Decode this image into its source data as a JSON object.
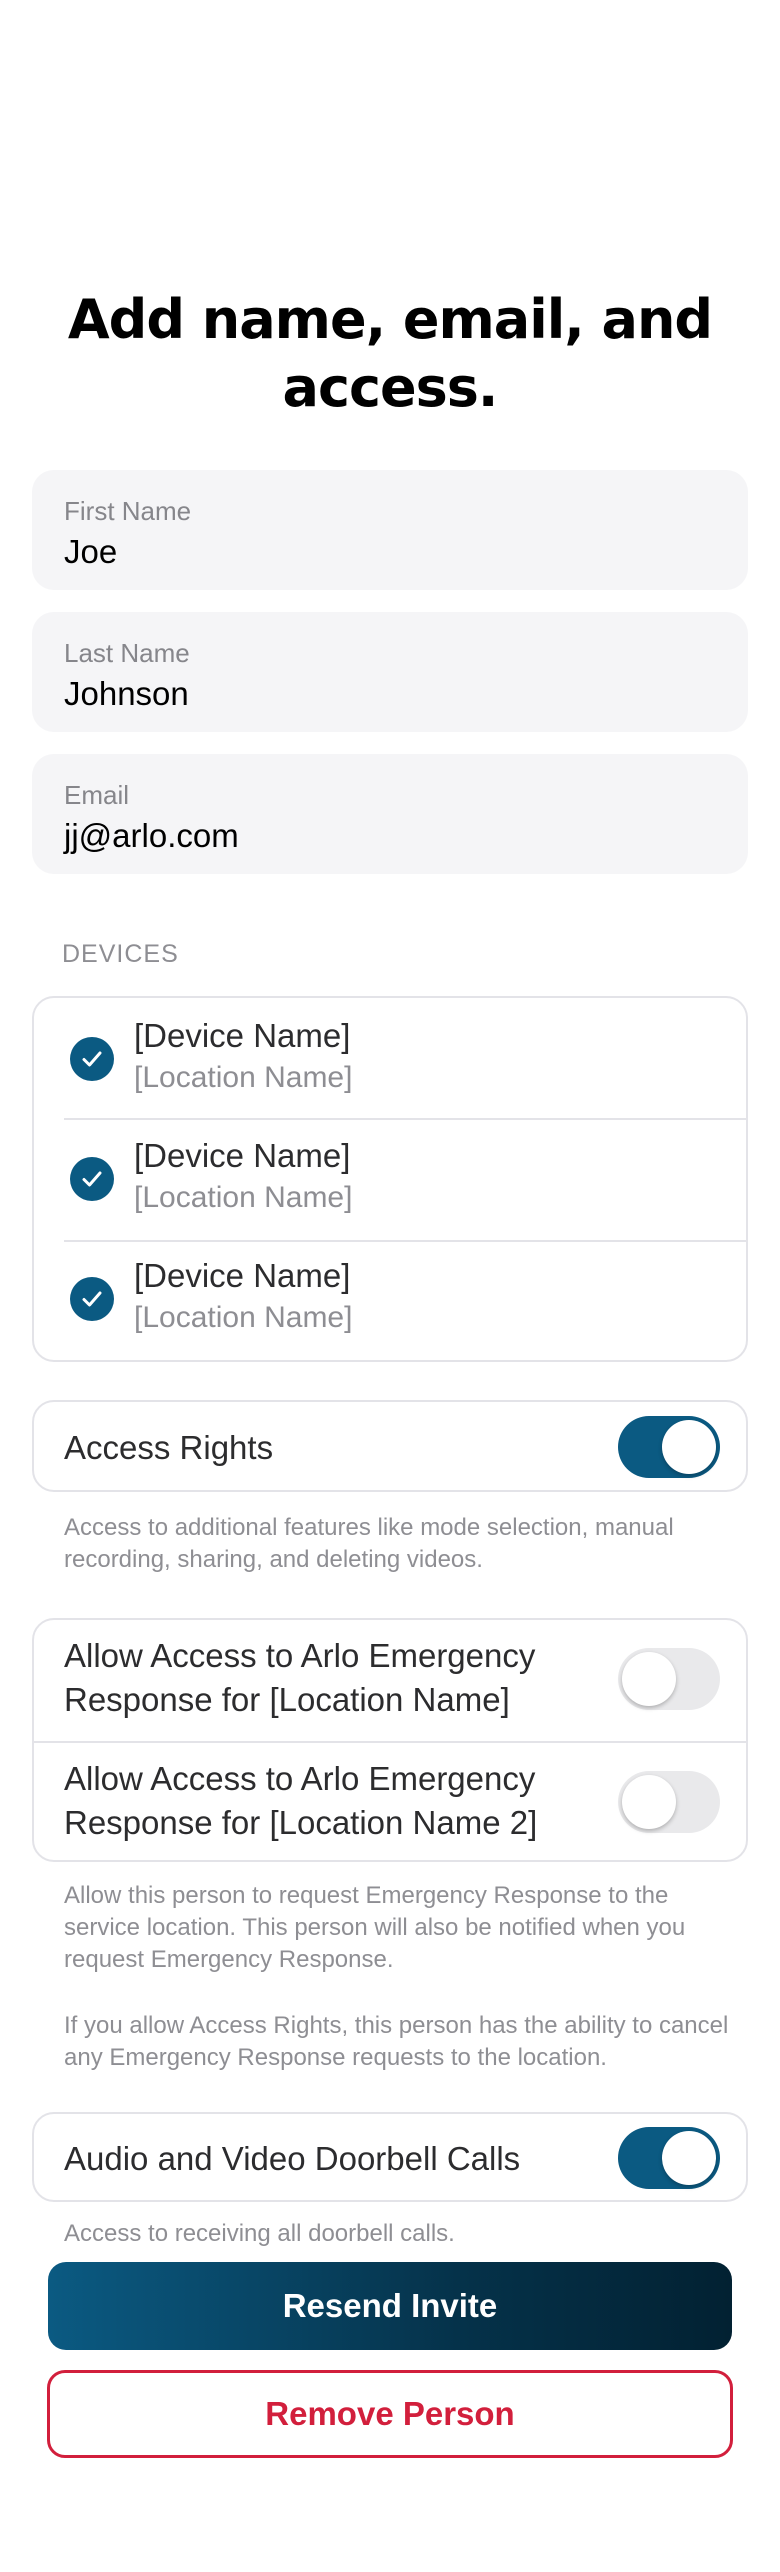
{
  "title_line1": "Add name, email, and",
  "title_line2": "access.",
  "fields": {
    "first_name": {
      "label": "First Name",
      "value": "Joe"
    },
    "last_name": {
      "label": "Last Name",
      "value": "Johnson"
    },
    "email": {
      "label": "Email",
      "value": "jj@arlo.com"
    }
  },
  "devices": {
    "section_label": "DEVICES",
    "items": [
      {
        "device": "[Device Name]",
        "location": "[Location Name]",
        "checked": true
      },
      {
        "device": "[Device Name]",
        "location": "[Location Name]",
        "checked": true
      },
      {
        "device": "[Device Name]",
        "location": "[Location Name]",
        "checked": true
      }
    ]
  },
  "access_rights": {
    "label": "Access Rights",
    "enabled": true,
    "note": "Access to additional features like mode selection, manual recording, sharing, and deleting videos."
  },
  "emergency": {
    "items": [
      {
        "line1": "Allow Access to Arlo Emergency",
        "line2": "Response for [Location Name]",
        "enabled": false
      },
      {
        "line1": "Allow Access to Arlo Emergency",
        "line2": "Response for [Location Name 2]",
        "enabled": false
      }
    ],
    "note1": "Allow this person to request Emergency Response to the service location. This person will also be notified when you request Emergency Response.",
    "note2": "If you allow Access Rights, this person has the ability to cancel any Emergency Response requests to the location."
  },
  "doorbell": {
    "label": "Audio and Video Doorbell Calls",
    "enabled": true,
    "note": "Access to receiving all doorbell calls."
  },
  "buttons": {
    "resend": "Resend Invite",
    "remove": "Remove Person"
  },
  "colors": {
    "accent": "#0b5a82",
    "danger": "#d21f3c"
  }
}
